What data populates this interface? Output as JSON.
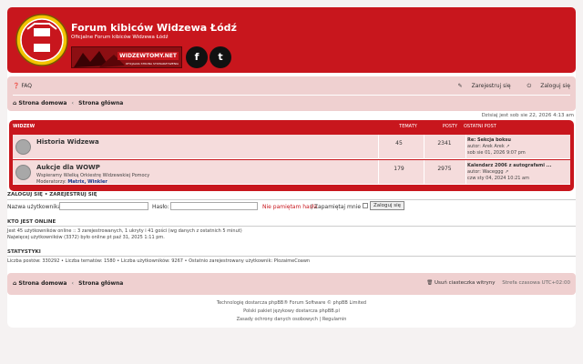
{
  "site": {
    "title": "Forum kibiców Widzewa Łódź",
    "description": "Oficjalne Forum kibiców Widzewa Łódź",
    "banner_label": "WIDZEWTOMY.NET",
    "banner_sub": "OFICJALNA STRONA STOWARZYSZENIA",
    "facebook_glyph": "f",
    "twitter_glyph": "t"
  },
  "nav": {
    "faq": "FAQ",
    "register": "Zarejestruj się",
    "login": "Zaloguj się",
    "crumb_home": "Strona domowa",
    "crumb_sep": "‹",
    "crumb_main": "Strona główna"
  },
  "date": "Dzisiaj jest sob sie 22, 2026 4:13 am",
  "forums": {
    "headers": {
      "forum": "WIDZEW",
      "topics": "TEMATY",
      "posts": "POSTY",
      "last": "OSTATNI POST"
    },
    "rows": [
      {
        "name": "Historia Widzewa",
        "desc": "",
        "mods_label": "",
        "mods": "",
        "topics": "45",
        "posts": "2341",
        "last_title": "Re: Sekcja boksu",
        "last_author": "autor: Arek Arek",
        "last_date": "sob sie 01, 2026 9:07 pm"
      },
      {
        "name": "Aukcje dla WOWP",
        "desc": "Wspieramy Wielką Orkiestrę Widzewskiej Pomocy",
        "mods_label": "Moderatorzy:",
        "mods": "Matrix, Winkler",
        "topics": "179",
        "posts": "2975",
        "last_title": "Kalendarz 2006 z autografami ...",
        "last_author": "autor: Waceggg",
        "last_date": "czw sty 04, 2024 10:21 am"
      }
    ]
  },
  "login": {
    "title": "ZALOGUJ SIĘ • ZAREJESTRUJ SIĘ",
    "username_label": "Nazwa użytkownika:",
    "password_label": "Hasło:",
    "forgot": "Nie pamiętam hasła",
    "remember": "| Zapamiętaj mnie",
    "button": "Zaloguj się"
  },
  "online": {
    "title": "KTO JEST ONLINE",
    "line1": "Jest 45 użytkowników online :: 3 zarejestrowanych, 1 ukryty i 41 gości (wg danych z ostatnich 5 minut)",
    "line2": "Najwięcej użytkowników (3372) było online pt paź 31, 2025 1:11 pm."
  },
  "stats": {
    "title": "STATYSTYKI",
    "line": "Liczba postów: 330292 • Liczba tematów: 1580 • Liczba użytkowników: 9267 • Ostatnio zarejestrowany użytkownik: PlozaimeCoawn"
  },
  "footer": {
    "crumb_home": "Strona domowa",
    "crumb_sep": "‹",
    "crumb_main": "Strona główna",
    "cookies": "Usuń ciasteczka witryny",
    "timezone": "Strefa czasowa UTC+02:00",
    "credit1": "Technologię dostarcza phpBB® Forum Software © phpBB Limited",
    "credit2": "Polski pakiet językowy dostarcza phpBB.pl",
    "credit3": "Zasady ochrony danych osobowych | Regulamin"
  },
  "colors": {
    "brand_red": "#c8161d",
    "nav_bg": "#efd0d0",
    "row_bg": "#f5dcdc"
  }
}
